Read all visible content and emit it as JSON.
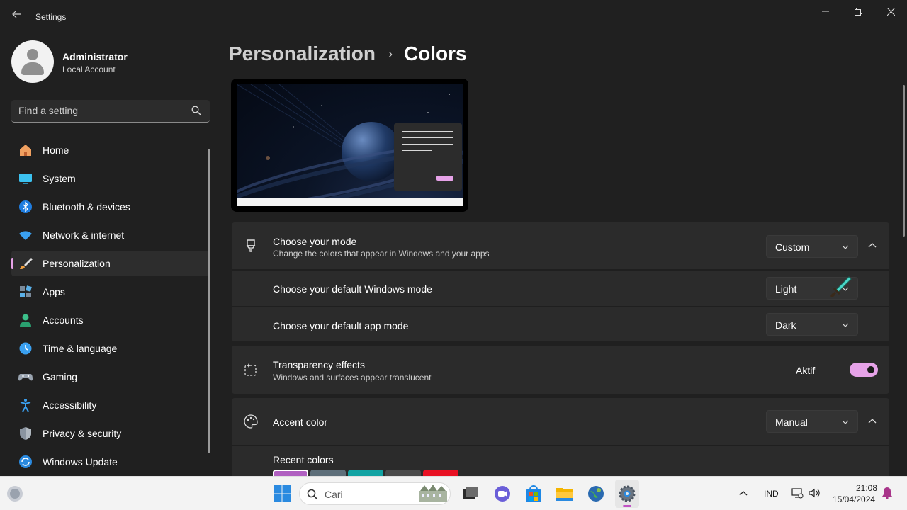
{
  "window": {
    "title": "Settings"
  },
  "profile": {
    "name": "Administrator",
    "account_type": "Local Account"
  },
  "search": {
    "placeholder": "Find a setting"
  },
  "sidebar": {
    "items": [
      {
        "label": "Home",
        "icon": "home-icon"
      },
      {
        "label": "System",
        "icon": "system-icon"
      },
      {
        "label": "Bluetooth & devices",
        "icon": "bluetooth-icon"
      },
      {
        "label": "Network & internet",
        "icon": "wifi-icon"
      },
      {
        "label": "Personalization",
        "icon": "brush-icon",
        "active": true
      },
      {
        "label": "Apps",
        "icon": "apps-icon"
      },
      {
        "label": "Accounts",
        "icon": "account-icon"
      },
      {
        "label": "Time & language",
        "icon": "clock-globe-icon"
      },
      {
        "label": "Gaming",
        "icon": "gamepad-icon"
      },
      {
        "label": "Accessibility",
        "icon": "accessibility-icon"
      },
      {
        "label": "Privacy & security",
        "icon": "shield-icon"
      },
      {
        "label": "Windows Update",
        "icon": "update-icon"
      }
    ]
  },
  "breadcrumb": {
    "parent": "Personalization",
    "separator": "›",
    "current": "Colors"
  },
  "mode": {
    "title": "Choose your mode",
    "description": "Change the colors that appear in Windows and your apps",
    "value": "Custom",
    "windows_mode_label": "Choose your default Windows mode",
    "windows_mode_value": "Light",
    "app_mode_label": "Choose your default app mode",
    "app_mode_value": "Dark"
  },
  "transparency": {
    "title": "Transparency effects",
    "description": "Windows and surfaces appear translucent",
    "state_label": "Aktif",
    "enabled": true
  },
  "accent": {
    "title": "Accent color",
    "value": "Manual",
    "recent_label": "Recent colors",
    "recent_colors": [
      "#b05fc1",
      "#5e6f7a",
      "#12a3a3",
      "#4a4a4a",
      "#e81123"
    ]
  },
  "taskbar": {
    "search_placeholder": "Cari",
    "language": "IND",
    "time": "21:08",
    "date": "15/04/2024"
  },
  "colors": {
    "accent": "#e6a2e8",
    "background": "#202020",
    "card": "#2b2b2b"
  }
}
